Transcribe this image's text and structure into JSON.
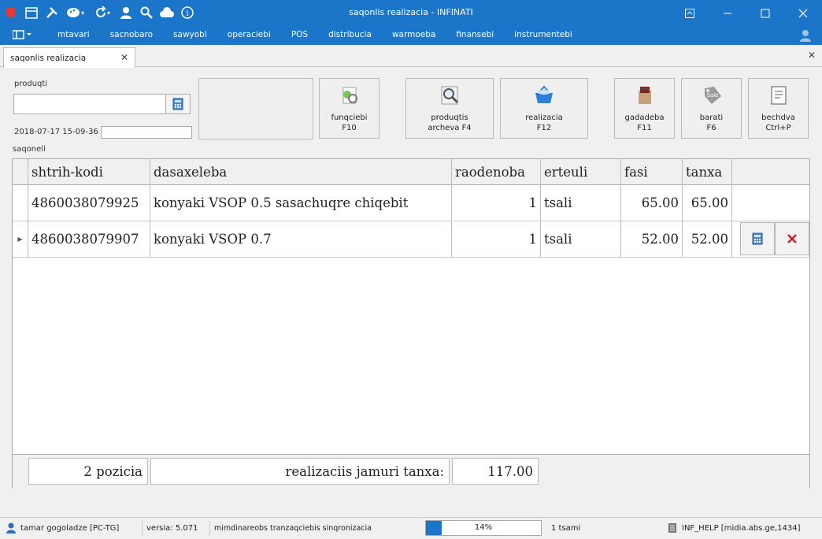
{
  "window": {
    "title": "saqonlis realizacia - INFINATI"
  },
  "menubar": {
    "items": [
      "mtavari",
      "sacnobaro",
      "sawyobi",
      "operaciebi",
      "POS",
      "distribucia",
      "warmoeba",
      "finansebi",
      "instrumentebi"
    ]
  },
  "tab": {
    "label": "saqonlis realizacia"
  },
  "form": {
    "product_label": "produqti",
    "product_value": "",
    "datetime": "2018-07-17 15-09-36",
    "datetime_extra": "",
    "goods_label": "saqoneli"
  },
  "toolbar": {
    "buttons": [
      {
        "label1": "funqciebi",
        "label2": "F10",
        "icon": "functions-icon"
      },
      {
        "label1": "produqtis",
        "label2": "archeva F4",
        "icon": "magnifier-icon"
      },
      {
        "label1": "realizacia",
        "label2": "F12",
        "icon": "basket-icon"
      },
      {
        "label1": "gadadeba",
        "label2": "F11",
        "icon": "bag-icon"
      },
      {
        "label1": "barati",
        "label2": "F6",
        "icon": "sale-tag-icon"
      },
      {
        "label1": "bechdva",
        "label2": "Ctrl+P",
        "icon": "printer-icon"
      }
    ]
  },
  "grid": {
    "columns": [
      "shtrih-kodi",
      "dasaxeleba",
      "raodenoba",
      "erteuli",
      "fasi",
      "tanxa"
    ],
    "rows": [
      {
        "barcode": "4860038079925",
        "name": "konyaki VSOP 0.5 sasachuqre chiqebit",
        "qty": "1",
        "unit": "tsali",
        "price": "65.00",
        "total": "65.00"
      },
      {
        "barcode": "4860038079907",
        "name": "konyaki VSOP 0.7",
        "qty": "1",
        "unit": "tsali",
        "price": "52.00",
        "total": "52.00"
      }
    ],
    "footer": {
      "positions": "2 pozicia",
      "total_label": "realizaciis jamuri tanxa:",
      "total_value": "117.00"
    }
  },
  "status": {
    "user": "tamar gogoladze [PC-TG]",
    "version": "versia: 5.071",
    "sync": "mimdinareobs tranzaqciebis sinqronizacia",
    "progress_percent": 14,
    "progress_text": "14%",
    "elapsed": "1 tsami",
    "server": "INF_HELP [midia.abs.ge,1434]"
  },
  "colors": {
    "accent": "#1b75c9",
    "delete": "#cc2020"
  }
}
